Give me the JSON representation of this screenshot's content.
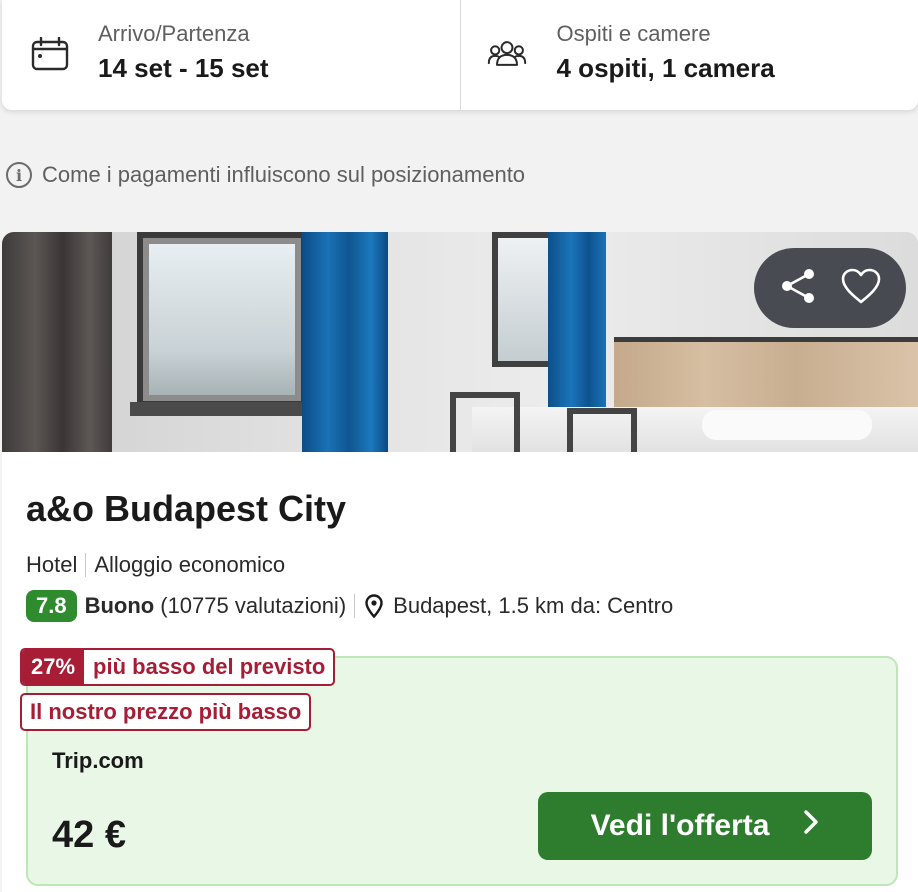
{
  "search": {
    "dates_label": "Arrivo/Partenza",
    "dates_value": "14 set - 15 set",
    "guests_label": "Ospiti e camere",
    "guests_value": "4 ospiti, 1 camera"
  },
  "info": {
    "text": "Come i pagamenti influiscono sul posizionamento"
  },
  "hotel": {
    "name": "a&o Budapest City",
    "type": "Hotel",
    "category": "Alloggio economico",
    "rating": "7.8",
    "rating_word": "Buono",
    "reviews": "(10775 valutazioni)",
    "location": "Budapest, 1.5 km da: Centro"
  },
  "offer": {
    "discount_pct": "27%",
    "discount_text": "più basso del previsto",
    "lowest_tag": "Il nostro prezzo più basso",
    "provider": "Trip.com",
    "price": "42 €",
    "cta_label": "Vedi l'offerta"
  },
  "colors": {
    "rating_badge": "#2e8b2e",
    "cta": "#2e7d2e",
    "tag": "#a61d35",
    "offer_bg": "#e9f7e6"
  },
  "icons": [
    "calendar-icon",
    "guests-icon",
    "info-icon",
    "share-icon",
    "heart-icon",
    "location-pin-icon",
    "chevron-right-icon"
  ]
}
